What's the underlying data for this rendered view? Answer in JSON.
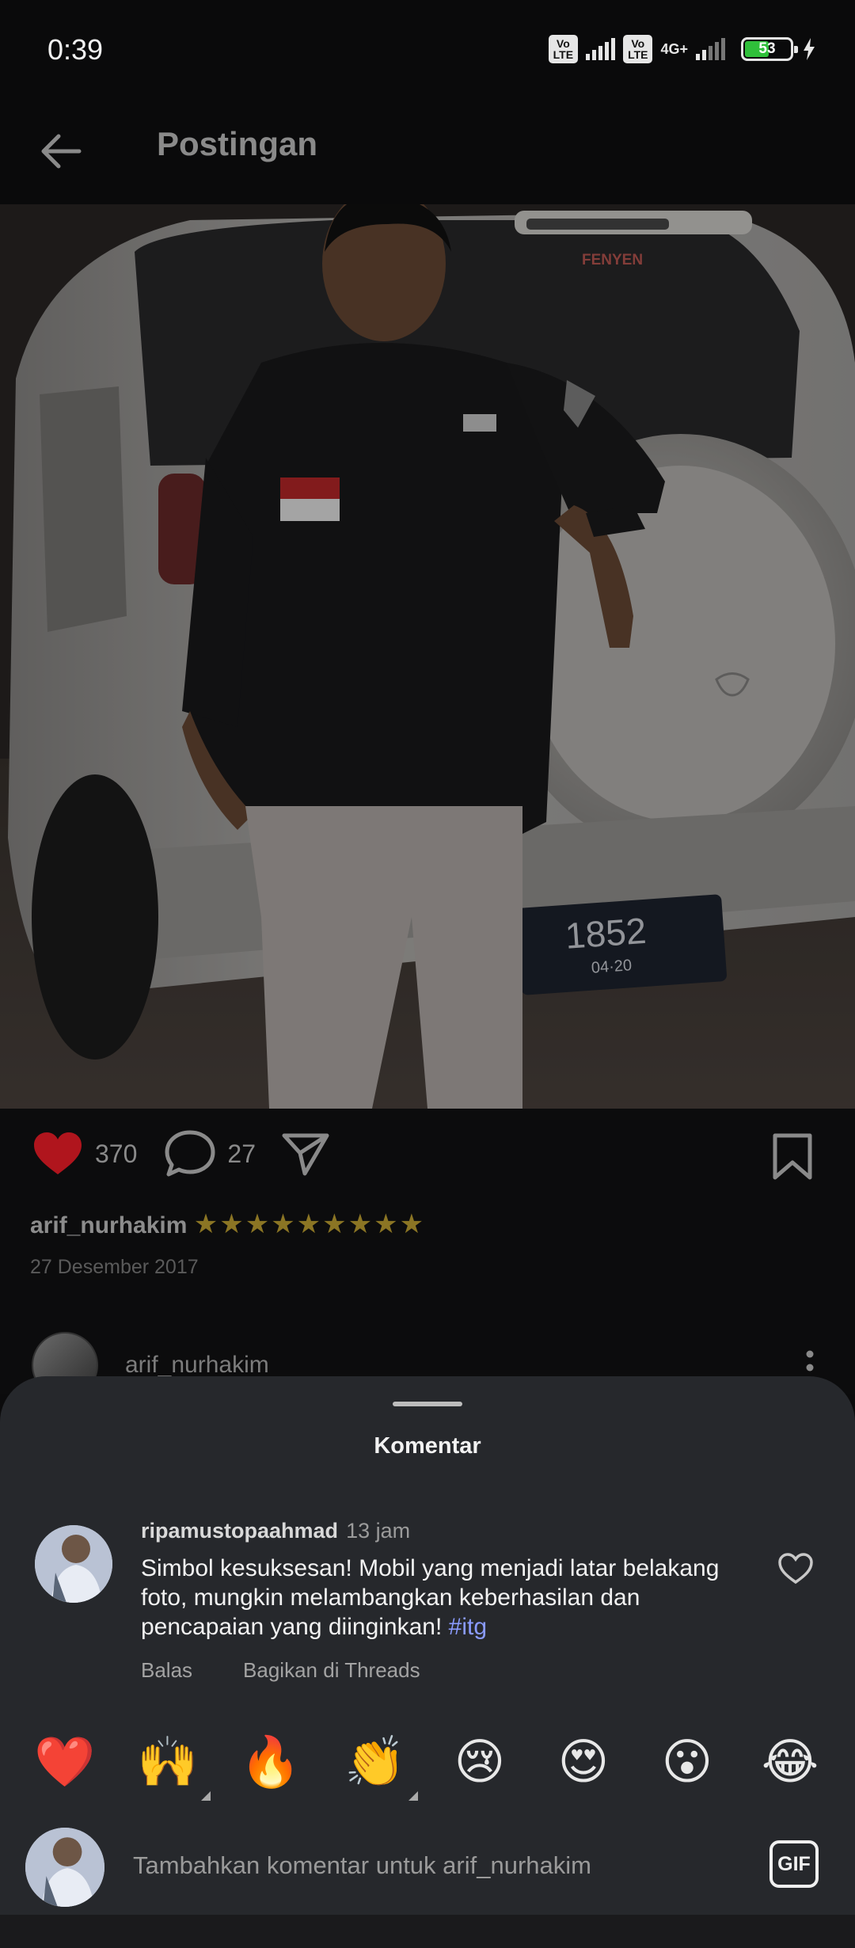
{
  "status_bar": {
    "time": "0:39",
    "volte_label": "Vo LTE",
    "network": "4G+",
    "battery_level": "53",
    "battery_fraction": 0.53
  },
  "header": {
    "title": "Postingan",
    "back_icon": "arrow-left-icon"
  },
  "photo": {
    "car_badge": "FENYEN",
    "plate_number": "1852",
    "plate_date": "04·20"
  },
  "post": {
    "likes": "370",
    "comments": "27",
    "username": "arif_nurhakim",
    "caption_stars": "★★★★★★★★★",
    "date": "27 Desember 2017",
    "icons": [
      "heart-icon",
      "comment-icon",
      "share-icon",
      "bookmark-icon",
      "more-vertical-icon"
    ]
  },
  "comment_preview": {
    "username": "arif_nurhakim"
  },
  "comments_sheet": {
    "title": "Komentar",
    "comment": {
      "username": "ripamustopaahmad",
      "time": "13 jam",
      "text": "Simbol kesuksesan! Mobil yang menjadi latar belakang foto, mungkin melambangkan keberhasilan dan pencapaian yang diinginkan!",
      "hashtag": "#itg",
      "reply_label": "Balas",
      "share_threads_label": "Bagikan di Threads"
    },
    "emojis": [
      "❤️",
      "🙌",
      "🔥",
      "👏",
      "😢",
      "😍",
      "😮",
      "😂"
    ],
    "input_placeholder": "Tambahkan komentar untuk arif_nurhakim",
    "gif_label": "GIF"
  },
  "colors": {
    "like_red": "#b0151d",
    "star_gold": "#8b7524",
    "hashtag_blue": "#8a9bff",
    "sheet_bg": "#26282c"
  }
}
